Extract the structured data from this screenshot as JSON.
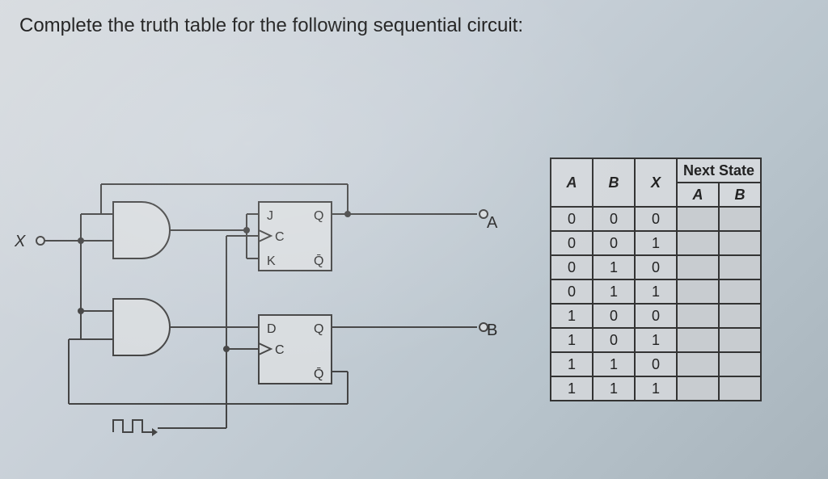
{
  "question": "Complete the truth table for the following sequential circuit:",
  "labels": {
    "x": "X",
    "a": "A",
    "b": "B",
    "j": "J",
    "k": "K",
    "q": "Q",
    "qbar": "Q̄",
    "d": "D",
    "c": "C"
  },
  "table": {
    "header_group": "Next State",
    "columns": [
      "A",
      "B",
      "X",
      "A",
      "B"
    ],
    "rows": [
      {
        "A": "0",
        "B": "0",
        "X": "0",
        "NA": "",
        "NB": ""
      },
      {
        "A": "0",
        "B": "0",
        "X": "1",
        "NA": "",
        "NB": ""
      },
      {
        "A": "0",
        "B": "1",
        "X": "0",
        "NA": "",
        "NB": ""
      },
      {
        "A": "0",
        "B": "1",
        "X": "1",
        "NA": "",
        "NB": ""
      },
      {
        "A": "1",
        "B": "0",
        "X": "0",
        "NA": "",
        "NB": ""
      },
      {
        "A": "1",
        "B": "0",
        "X": "1",
        "NA": "",
        "NB": ""
      },
      {
        "A": "1",
        "B": "1",
        "X": "0",
        "NA": "",
        "NB": ""
      },
      {
        "A": "1",
        "B": "1",
        "X": "1",
        "NA": "",
        "NB": ""
      }
    ]
  },
  "chart_data": {
    "type": "table",
    "title": "Sequential circuit truth table (next state to be completed)",
    "columns": [
      "A",
      "B",
      "X",
      "Next A",
      "Next B"
    ],
    "rows": [
      [
        0,
        0,
        0,
        null,
        null
      ],
      [
        0,
        0,
        1,
        null,
        null
      ],
      [
        0,
        1,
        0,
        null,
        null
      ],
      [
        0,
        1,
        1,
        null,
        null
      ],
      [
        1,
        0,
        0,
        null,
        null
      ],
      [
        1,
        0,
        1,
        null,
        null
      ],
      [
        1,
        1,
        0,
        null,
        null
      ],
      [
        1,
        1,
        1,
        null,
        null
      ]
    ],
    "circuit": {
      "flipflops": [
        {
          "type": "JK",
          "output": "A"
        },
        {
          "type": "D",
          "output": "B"
        }
      ],
      "gates": [
        "AND (2-input)",
        "AND (2-input)"
      ],
      "inputs": [
        "X"
      ],
      "clock": true
    }
  }
}
